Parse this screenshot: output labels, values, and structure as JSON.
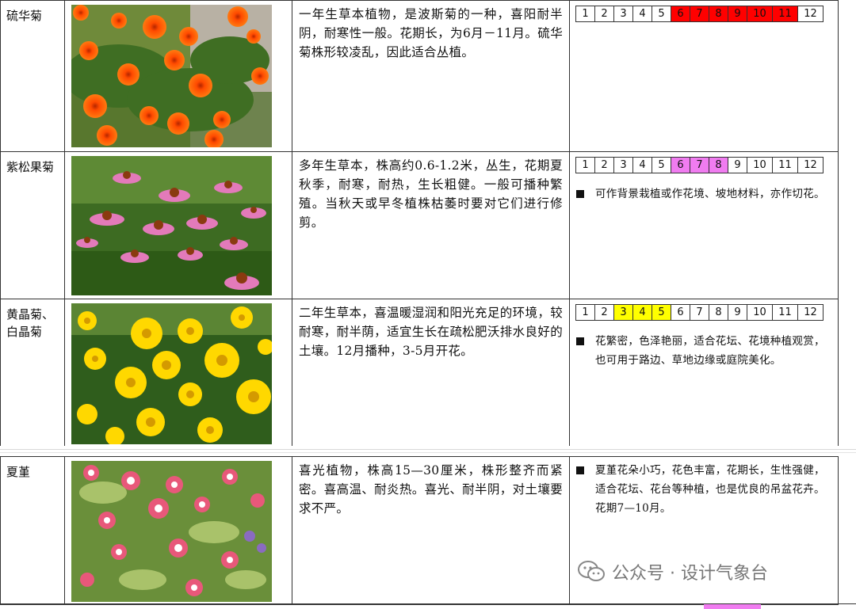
{
  "colors": {
    "red": "#ff0000",
    "magenta": "#f07cf0",
    "yellow": "#ffff00"
  },
  "month_labels": [
    "1",
    "2",
    "3",
    "4",
    "5",
    "6",
    "7",
    "8",
    "9",
    "10",
    "11",
    "12"
  ],
  "plants": [
    {
      "name": "硫华菊",
      "photo": "orange-cosmos-flowers-photo",
      "description": "一年生草本植物，是波斯菊的一种，喜阳耐半阴，耐寒性一般。花期长，为6月－11月。硫华菊株形较凌乱，因此适合丛植。",
      "bloom_months": [
        6,
        7,
        8,
        9,
        10,
        11
      ],
      "highlight": "red",
      "note": ""
    },
    {
      "name": "紫松果菊",
      "photo": "purple-coneflower-photo",
      "description": "多年生草本，株高约0.6-1.2米，丛生，花期夏秋季，耐寒，耐热，生长粗健。一般可播种繁殖。当秋天或早冬植株枯萎时要对它们进行修剪。",
      "bloom_months": [
        6,
        7,
        8
      ],
      "highlight": "magenta",
      "note": "可作背景栽植或作花境、坡地材料，亦作切花。"
    },
    {
      "name": "黄晶菊、白晶菊",
      "photo": "yellow-daisy-photo",
      "description": "二年生草本，喜温暖湿润和阳光充足的环境，较耐寒，耐半荫，适宜生长在疏松肥沃排水良好的土壤。12月播种，3-5月开花。",
      "bloom_months": [
        3,
        4,
        5
      ],
      "highlight": "yellow",
      "note": "花繁密，色泽艳丽，适合花坛、花境种植观赏，也可用于路边、草地边缘或庭院美化。"
    },
    {
      "name": "夏堇",
      "photo": "torenia-flowers-photo",
      "description": "喜光植物，株高15—30厘米，株形整齐而紧密。喜高温、耐炎热。喜光、耐半阴，对土壤要求不严。",
      "bloom_months": [],
      "highlight": "",
      "note": "夏堇花朵小巧，花色丰富，花期长，生性强健，适合花坛、花台等种植，也是优良的吊盆花卉。花期7—10月。"
    }
  ],
  "watermark": "公众号 · 设计气象台"
}
